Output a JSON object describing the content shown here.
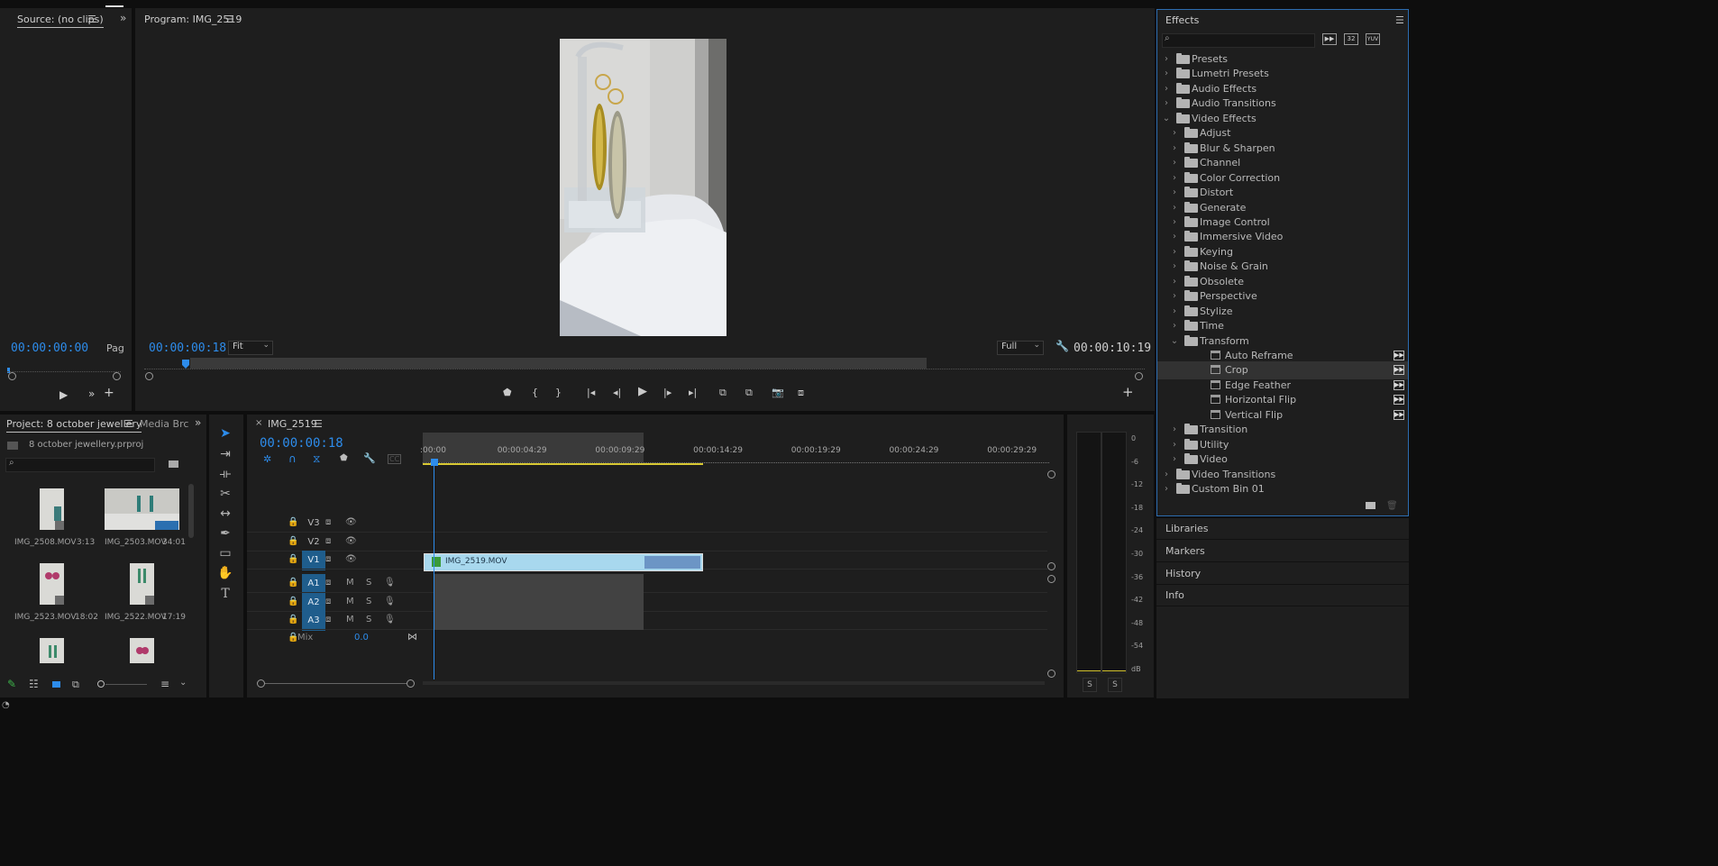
{
  "source": {
    "tab": "Source: (no clips)",
    "timecode": "00:00:00:00",
    "page_label": "Pag"
  },
  "program": {
    "tab": "Program: IMG_2519",
    "timecode": "00:00:00:18",
    "fit": "Fit",
    "quality": "Full",
    "duration": "00:00:10:19"
  },
  "effects": {
    "title": "Effects",
    "items": [
      {
        "label": "Presets",
        "level": 0,
        "open": false,
        "kind": "bin"
      },
      {
        "label": "Lumetri Presets",
        "level": 0,
        "open": false,
        "kind": "bin"
      },
      {
        "label": "Audio Effects",
        "level": 0,
        "open": false,
        "kind": "folder"
      },
      {
        "label": "Audio Transitions",
        "level": 0,
        "open": false,
        "kind": "folder"
      },
      {
        "label": "Video Effects",
        "level": 0,
        "open": true,
        "kind": "folder"
      },
      {
        "label": "Adjust",
        "level": 1,
        "open": false,
        "kind": "folder"
      },
      {
        "label": "Blur & Sharpen",
        "level": 1,
        "open": false,
        "kind": "folder"
      },
      {
        "label": "Channel",
        "level": 1,
        "open": false,
        "kind": "folder"
      },
      {
        "label": "Color Correction",
        "level": 1,
        "open": false,
        "kind": "folder"
      },
      {
        "label": "Distort",
        "level": 1,
        "open": false,
        "kind": "folder"
      },
      {
        "label": "Generate",
        "level": 1,
        "open": false,
        "kind": "folder"
      },
      {
        "label": "Image Control",
        "level": 1,
        "open": false,
        "kind": "folder"
      },
      {
        "label": "Immersive Video",
        "level": 1,
        "open": false,
        "kind": "folder"
      },
      {
        "label": "Keying",
        "level": 1,
        "open": false,
        "kind": "folder"
      },
      {
        "label": "Noise & Grain",
        "level": 1,
        "open": false,
        "kind": "folder"
      },
      {
        "label": "Obsolete",
        "level": 1,
        "open": false,
        "kind": "folder"
      },
      {
        "label": "Perspective",
        "level": 1,
        "open": false,
        "kind": "folder"
      },
      {
        "label": "Stylize",
        "level": 1,
        "open": false,
        "kind": "folder"
      },
      {
        "label": "Time",
        "level": 1,
        "open": false,
        "kind": "folder"
      },
      {
        "label": "Transform",
        "level": 1,
        "open": true,
        "kind": "folder"
      },
      {
        "label": "Auto Reframe",
        "level": 2,
        "kind": "effect",
        "selected": false
      },
      {
        "label": "Crop",
        "level": 2,
        "kind": "effect",
        "selected": true
      },
      {
        "label": "Edge Feather",
        "level": 2,
        "kind": "effect",
        "selected": false
      },
      {
        "label": "Horizontal Flip",
        "level": 2,
        "kind": "effect",
        "selected": false
      },
      {
        "label": "Vertical Flip",
        "level": 2,
        "kind": "effect",
        "selected": false
      },
      {
        "label": "Transition",
        "level": 1,
        "open": false,
        "kind": "folder"
      },
      {
        "label": "Utility",
        "level": 1,
        "open": false,
        "kind": "folder"
      },
      {
        "label": "Video",
        "level": 1,
        "open": false,
        "kind": "folder"
      },
      {
        "label": "Video Transitions",
        "level": 0,
        "open": false,
        "kind": "folder"
      },
      {
        "label": "Custom Bin 01",
        "level": 0,
        "open": false,
        "kind": "folder"
      }
    ]
  },
  "side_panels": [
    "Libraries",
    "Markers",
    "History",
    "Info"
  ],
  "project": {
    "tab": "Project: 8 october jewellery",
    "tab2": "Media Brc",
    "filename": "8 october jewellery.prproj",
    "clips": [
      {
        "name": "IMG_2508.MOV",
        "duration": "3:13"
      },
      {
        "name": "IMG_2503.MOV",
        "duration": "34:01"
      },
      {
        "name": "IMG_2523.MOV",
        "duration": "18:02"
      },
      {
        "name": "IMG_2522.MOV",
        "duration": "17:19"
      }
    ]
  },
  "timeline": {
    "tab": "IMG_2519",
    "timecode": "00:00:00:18",
    "ruler": [
      ":00:00",
      "00:00:04:29",
      "00:00:09:29",
      "00:00:14:29",
      "00:00:19:29",
      "00:00:24:29",
      "00:00:29:29"
    ],
    "video_tracks": [
      "V3",
      "V2",
      "V1"
    ],
    "audio_tracks": [
      "A1",
      "A2",
      "A3"
    ],
    "clip_name": "IMG_2519.MOV",
    "mix_label": "Mix",
    "mix_value": "0.0"
  },
  "meter": {
    "scale": [
      "0",
      "-6",
      "-12",
      "-18",
      "-24",
      "-30",
      "-36",
      "-42",
      "-48",
      "-54",
      "dB"
    ],
    "solo": [
      "S",
      "S"
    ]
  }
}
